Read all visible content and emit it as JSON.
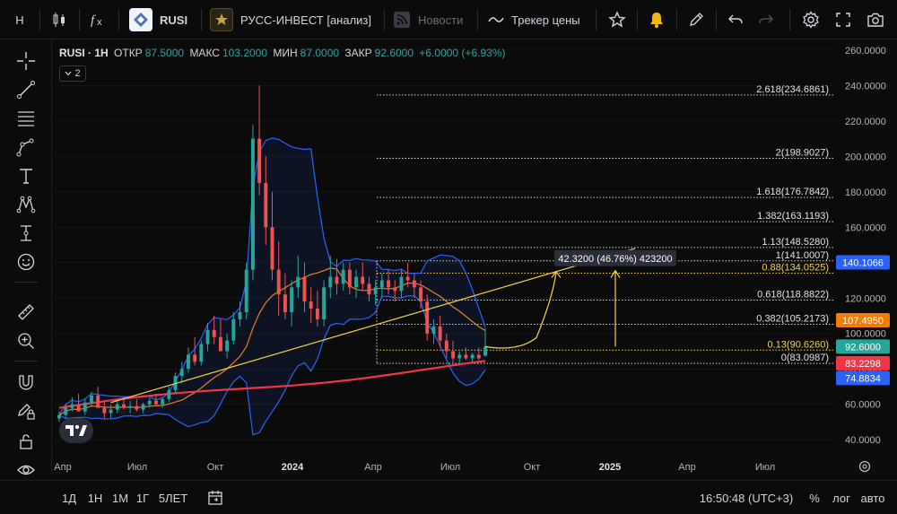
{
  "app": {
    "symbol_short": "RUSI",
    "company": "РУСС-ИНВЕСТ [анализ]",
    "news_label": "Новости",
    "price_tracker_label": "Трекер цены",
    "symbol_letter": "H"
  },
  "legend": {
    "title": "RUSI · 1H",
    "open_key": "ОТКР",
    "open": "87.5000",
    "high_key": "МАКС",
    "high": "103.2000",
    "low_key": "МИН",
    "low": "87.0000",
    "close_key": "ЗАКР",
    "close": "92.6000",
    "change": "+6.0000 (+6.93%)",
    "indicators_count": "2"
  },
  "colors": {
    "bull": "#26a69a",
    "bear": "#ef5350",
    "ma_red": "#f23645",
    "ma_orange": "#e8801f",
    "bollinger": "#2962ff",
    "trend": "#f5d340",
    "fib_gold": "#f5d340",
    "price_label_blue": "#2962ff",
    "price_label_green": "#26a69a",
    "price_label_orange": "#f57c00",
    "price_label_red": "#f23645"
  },
  "chart_data": {
    "type": "candlestick",
    "price_axis": {
      "min": 32,
      "max": 266,
      "ticks": [
        "260.0000",
        "240.0000",
        "220.0000",
        "200.0000",
        "180.0000",
        "160.0000",
        "140.0000",
        "120.0000",
        "100.0000",
        "80.0000",
        "60.0000",
        "40.0000"
      ],
      "tick_values": [
        260,
        240,
        220,
        200,
        180,
        160,
        140,
        120,
        100,
        80,
        60,
        40
      ]
    },
    "time_axis": {
      "labels": [
        "Апр",
        "Июл",
        "Окт",
        "2024",
        "Апр",
        "Июл",
        "Окт",
        "2025",
        "Апр",
        "Июл"
      ],
      "label_index": [
        0,
        12.7,
        25.4,
        38.1,
        50.8,
        63.5,
        76.2,
        88.9,
        101.6,
        114.3
      ],
      "bar_count": 123
    },
    "candles": [
      [
        52,
        56,
        50,
        54
      ],
      [
        54,
        60,
        52,
        58
      ],
      [
        58,
        64,
        56,
        60
      ],
      [
        60,
        66,
        57,
        56
      ],
      [
        56,
        63,
        54,
        61
      ],
      [
        61,
        67,
        59,
        65
      ],
      [
        65,
        70,
        60,
        58
      ],
      [
        58,
        62,
        52,
        55
      ],
      [
        55,
        60,
        52,
        57
      ],
      [
        57,
        62,
        55,
        60
      ],
      [
        60,
        64,
        57,
        58
      ],
      [
        58,
        62,
        55,
        59
      ],
      [
        59,
        63,
        56,
        57
      ],
      [
        57,
        61,
        55,
        60
      ],
      [
        60,
        64,
        58,
        62
      ],
      [
        62,
        66,
        59,
        60
      ],
      [
        60,
        64,
        58,
        63
      ],
      [
        63,
        70,
        61,
        68
      ],
      [
        68,
        78,
        66,
        76
      ],
      [
        76,
        84,
        72,
        80
      ],
      [
        80,
        92,
        78,
        88
      ],
      [
        88,
        98,
        82,
        84
      ],
      [
        84,
        96,
        82,
        94
      ],
      [
        94,
        106,
        90,
        102
      ],
      [
        102,
        110,
        94,
        98
      ],
      [
        98,
        108,
        92,
        90
      ],
      [
        90,
        100,
        86,
        96
      ],
      [
        96,
        112,
        94,
        108
      ],
      [
        108,
        118,
        104,
        112
      ],
      [
        112,
        140,
        108,
        136
      ],
      [
        136,
        218,
        130,
        210
      ],
      [
        210,
        240,
        178,
        185
      ],
      [
        185,
        200,
        150,
        160
      ],
      [
        160,
        180,
        130,
        136
      ],
      [
        136,
        152,
        110,
        122
      ],
      [
        122,
        134,
        108,
        112
      ],
      [
        112,
        130,
        104,
        126
      ],
      [
        126,
        144,
        120,
        132
      ],
      [
        132,
        140,
        112,
        118
      ],
      [
        118,
        126,
        106,
        114
      ],
      [
        114,
        124,
        104,
        108
      ],
      [
        108,
        130,
        104,
        126
      ],
      [
        126,
        144,
        120,
        132
      ],
      [
        132,
        142,
        122,
        128
      ],
      [
        128,
        140,
        124,
        136
      ],
      [
        136,
        140,
        122,
        126
      ],
      [
        126,
        136,
        120,
        132
      ],
      [
        132,
        140,
        124,
        128
      ],
      [
        128,
        132,
        118,
        122
      ],
      [
        122,
        130,
        116,
        126
      ],
      [
        126,
        134,
        120,
        130
      ],
      [
        130,
        136,
        122,
        126
      ],
      [
        126,
        130,
        118,
        124
      ],
      [
        124,
        136,
        120,
        132
      ],
      [
        132,
        140,
        126,
        130
      ],
      [
        130,
        134,
        120,
        126
      ],
      [
        126,
        130,
        114,
        118
      ],
      [
        118,
        122,
        96,
        100
      ],
      [
        100,
        108,
        94,
        104
      ],
      [
        104,
        110,
        92,
        96
      ],
      [
        96,
        100,
        86,
        90
      ],
      [
        90,
        96,
        83,
        86
      ],
      [
        86,
        90,
        83,
        88
      ],
      [
        88,
        92,
        85,
        86
      ],
      [
        86,
        89,
        84,
        88
      ],
      [
        88,
        92,
        85,
        86
      ],
      [
        87.5,
        103.2,
        87,
        92.6
      ]
    ],
    "candles_note_x": "indices 0..30 span Apr→Dec 2023 region; remaining candles continue to end",
    "fib_levels": [
      {
        "ratio": "2.618",
        "price": 234.6861,
        "label": "2.618(234.6861)"
      },
      {
        "ratio": "2",
        "price": 198.9027,
        "label": "2(198.9027)"
      },
      {
        "ratio": "1.618",
        "price": 176.7842,
        "label": "1.618(176.7842)"
      },
      {
        "ratio": "1.382",
        "price": 163.1193,
        "label": "1.382(163.1193)"
      },
      {
        "ratio": "1.13",
        "price": 148.528,
        "label": "1.13(148.5280)"
      },
      {
        "ratio": "1",
        "price": 141.0007,
        "label": "1(141.0007)"
      },
      {
        "ratio": "0.88",
        "price": 134.0525,
        "label": "0.88(134.0525)",
        "highlight": true
      },
      {
        "ratio": "0.618",
        "price": 118.8822,
        "label": "0.618(118.8822)"
      },
      {
        "ratio": "0.382",
        "price": 105.2173,
        "label": "0.382(105.2173)"
      },
      {
        "ratio": "0.13",
        "price": 90.626,
        "label": "0.13(90.6260)",
        "highlight": true
      },
      {
        "ratio": "0",
        "price": 83.0987,
        "label": "0(83.0987)"
      }
    ],
    "price_labels": [
      {
        "text": "140.1066",
        "price": 140.1066,
        "color": "#2962ff"
      },
      {
        "text": "107.4950",
        "price": 107.495,
        "color": "#f57c00"
      },
      {
        "text": "92.6000",
        "price": 92.6,
        "color": "#26a69a"
      },
      {
        "text": "83.2298",
        "price": 83.2298,
        "color": "#f23645"
      },
      {
        "text": "74.8834",
        "price": 74.8834,
        "color": "#2962ff"
      }
    ],
    "measure_label": "42.3200 (46.76%) 423200"
  },
  "bottom": {
    "ranges": [
      "1Д",
      "1Н",
      "1М",
      "1Г",
      "5ЛЕТ"
    ],
    "clock": "16:50:48 (UTC+3)",
    "percent": "%",
    "log": "лог",
    "auto": "авто"
  },
  "icons": {
    "indicators": "fx-icon",
    "alert": "bell-icon",
    "settings": "gear-icon",
    "fullscreen": "fullscreen-icon",
    "snapshot": "camera-icon"
  }
}
